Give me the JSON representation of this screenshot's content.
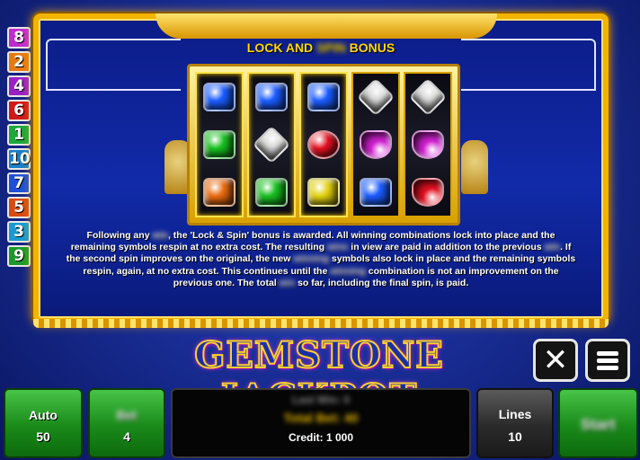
{
  "paylines": {
    "left_badges": [
      {
        "label": "8",
        "color": "#c02bd0"
      },
      {
        "label": "2",
        "color": "#e67a10"
      },
      {
        "label": "4",
        "color": "#9a1fc4"
      },
      {
        "label": "6",
        "color": "#d01818"
      },
      {
        "label": "1",
        "color": "#1ca83a"
      },
      {
        "label": "10",
        "color": "#1a7ec8"
      },
      {
        "label": "7",
        "color": "#1e4fd8"
      },
      {
        "label": "5",
        "color": "#d84a10"
      },
      {
        "label": "3",
        "color": "#1a9ad0"
      },
      {
        "label": "9",
        "color": "#1a9a2a"
      }
    ]
  },
  "help_page": {
    "title_pre": "LOCK AND",
    "title_blurred": "SPIN",
    "title_post": "BONUS",
    "text_parts": [
      "Following any ",
      "win",
      ", the 'Lock & Spin' bonus is awarded. All winning combinations lock into place and the remaining symbols respin at no extra cost. The resulting ",
      "wins",
      " in view are paid in addition to the previous ",
      "win",
      ". If the second spin improves on the original, the new ",
      "winning",
      " symbols also lock in place and the remaining symbols respin, again, at no extra cost. This continues until the ",
      "winning",
      " combination is not an improvement on the previous one. The total ",
      "win",
      " so far, including the final spin, is paid."
    ]
  },
  "reels": [
    {
      "locked": true,
      "symbols": [
        {
          "name": "blue-sapphire",
          "color": "#1a5cff",
          "shape": "gem"
        },
        {
          "name": "green-emerald",
          "color": "#18c020",
          "shape": "gem"
        },
        {
          "name": "orange-topaz",
          "color": "#e86a10",
          "shape": "gem"
        }
      ]
    },
    {
      "locked": true,
      "symbols": [
        {
          "name": "blue-sapphire",
          "color": "#1a5cff",
          "shape": "gem"
        },
        {
          "name": "white-diamond",
          "color": "#d8d8d8",
          "shape": "diamond"
        },
        {
          "name": "green-emerald",
          "color": "#18c020",
          "shape": "gem"
        }
      ]
    },
    {
      "locked": true,
      "symbols": [
        {
          "name": "blue-sapphire",
          "color": "#1a5cff",
          "shape": "gem"
        },
        {
          "name": "red-ruby",
          "color": "#e01020",
          "shape": "round"
        },
        {
          "name": "yellow-citrine",
          "color": "#e0d010",
          "shape": "gem"
        }
      ]
    },
    {
      "locked": false,
      "symbols": [
        {
          "name": "white-diamond",
          "color": "#d8d8d8",
          "shape": "diamond"
        },
        {
          "name": "purple-amethyst",
          "color": "#d020d0",
          "shape": "heart"
        },
        {
          "name": "blue-sapphire",
          "color": "#1a5cff",
          "shape": "gem"
        }
      ]
    },
    {
      "locked": false,
      "symbols": [
        {
          "name": "white-diamond",
          "color": "#d8d8d8",
          "shape": "diamond"
        },
        {
          "name": "purple-amethyst",
          "color": "#d020d0",
          "shape": "heart"
        },
        {
          "name": "red-ruby",
          "color": "#e01020",
          "shape": "heart"
        }
      ]
    }
  ],
  "logo": {
    "text": "GEMSTONE JACKPOT"
  },
  "controls": {
    "close_icon": "close-icon",
    "menu_icon": "menu-icon",
    "auto": {
      "label": "Auto",
      "value": "50"
    },
    "bet": {
      "label": "Bet",
      "value": "4"
    },
    "info": {
      "last_win": "Last Win: 0",
      "total_bet": "Total Bet: 40",
      "credit": "Credit: 1 000"
    },
    "lines": {
      "label": "Lines",
      "value": "10"
    },
    "start": {
      "label": "Start"
    }
  }
}
